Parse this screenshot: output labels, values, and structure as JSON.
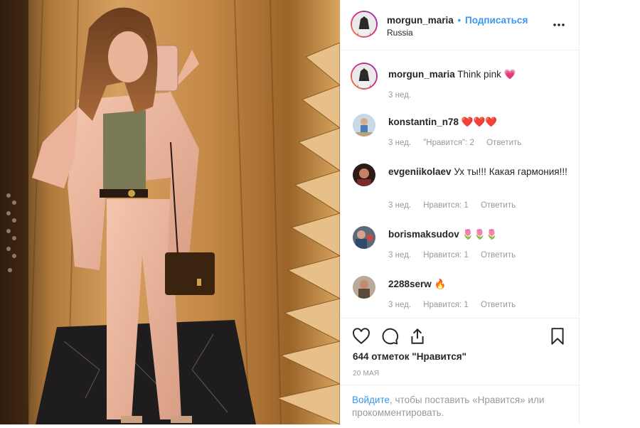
{
  "post": {
    "username": "morgun_maria",
    "follow_separator": "•",
    "follow_label": "Подписаться",
    "location": "Russia",
    "more_icon": "more-horizontal-icon",
    "caption": {
      "username": "morgun_maria",
      "text": "Think pink",
      "emoji": "💗",
      "time": "3 нед."
    },
    "likes": "644 отметок \"Нравится\"",
    "date": "20 МАЯ",
    "login_prompt": {
      "link": "Войдите",
      "text": ", чтобы поставить «Нравится» или прокомментировать."
    }
  },
  "comments": [
    {
      "username": "konstantin_n78",
      "text": "❤️❤️❤️",
      "time": "3 нед.",
      "likes": "\"Нравится\": 2",
      "reply": "Ответить"
    },
    {
      "username": "evgeniikolaev",
      "text": "Ух ты!!! Какая гармония!!!",
      "time": "3 нед.",
      "likes": "Нравится: 1",
      "reply": "Ответить"
    },
    {
      "username": "borismaksudov",
      "text": "🌷🌷🌷",
      "time": "3 нед.",
      "likes": "Нравится: 1",
      "reply": "Ответить"
    },
    {
      "username": "2288serw",
      "text": "🔥",
      "time": "3 нед.",
      "likes": "Нравится: 1",
      "reply": "Ответить"
    }
  ],
  "icons": {
    "like": "heart-icon",
    "comment": "comment-icon",
    "share": "share-icon",
    "save": "bookmark-icon"
  },
  "colors": {
    "link": "#3897f0",
    "muted": "#999999",
    "text": "#262626",
    "border": "#efefef"
  }
}
